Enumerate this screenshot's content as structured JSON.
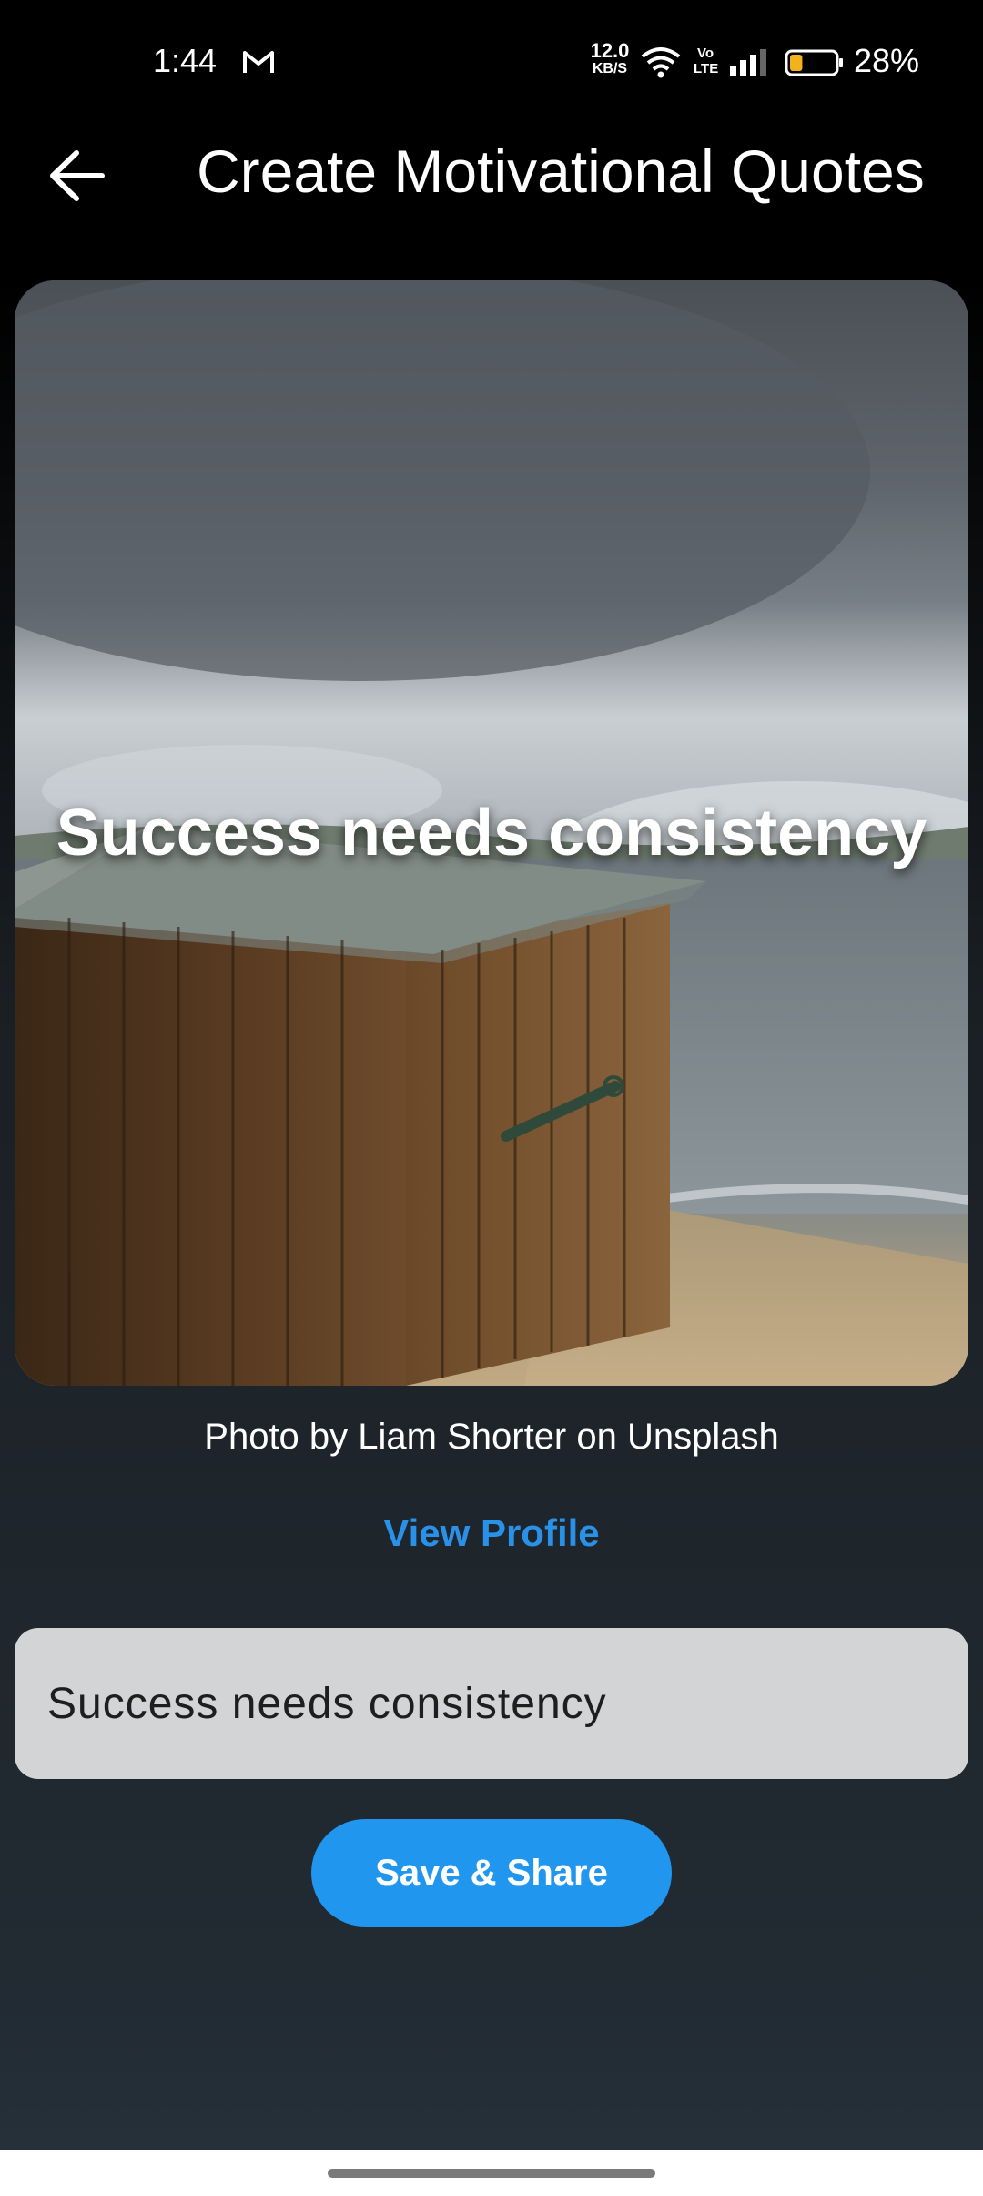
{
  "status_bar": {
    "time": "1:44",
    "net_speed_value": "12.0",
    "net_speed_unit": "KB/S",
    "volte": "Vo\nLTE",
    "battery_percent": "28%",
    "battery_level": 0.28,
    "icons": [
      "gmail-icon",
      "wifi-icon",
      "volte-icon",
      "signal-icon",
      "battery-icon"
    ]
  },
  "app_bar": {
    "title": "Create Motivational Quotes",
    "back_icon": "arrow-left-icon"
  },
  "preview": {
    "overlay_quote": "Success needs consistency",
    "credit": "Photo by Liam Shorter on Unsplash",
    "view_profile_label": "View Profile"
  },
  "editor": {
    "quote_value": "Success needs consistency"
  },
  "actions": {
    "save_share_label": "Save & Share"
  },
  "colors": {
    "accent": "#2196ef",
    "link": "#2a91e8",
    "input_bg": "#d3d4d5"
  }
}
